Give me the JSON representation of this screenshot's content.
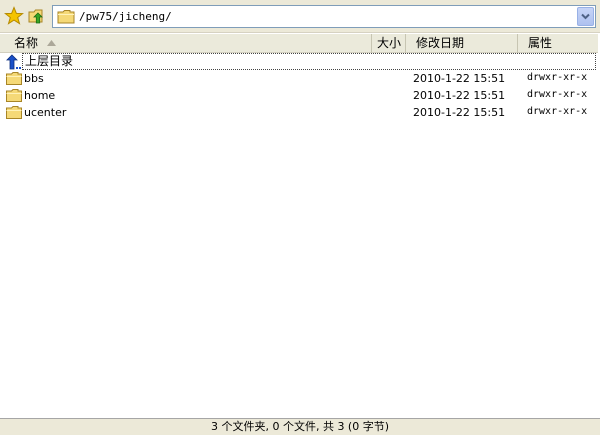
{
  "toolbar": {
    "favorites_icon": "star-icon",
    "up_icon": "folder-up-icon",
    "address": "/pw75/jicheng/"
  },
  "columns": {
    "name": "名称",
    "size": "大小",
    "date": "修改日期",
    "attr": "属性",
    "sort_column": "name",
    "sort_direction": "ascending"
  },
  "parent_row": {
    "label": "上层目录",
    "icon": "up-arrow-icon"
  },
  "files": [
    {
      "name": "bbs",
      "date": "2010-1-22 15:51",
      "attr": "drwxr-xr-x",
      "icon": "folder-icon"
    },
    {
      "name": "home",
      "date": "2010-1-22 15:51",
      "attr": "drwxr-xr-x",
      "icon": "folder-icon"
    },
    {
      "name": "ucenter",
      "date": "2010-1-22 15:51",
      "attr": "drwxr-xr-x",
      "icon": "folder-icon"
    }
  ],
  "status": {
    "text": "3 个文件夹, 0 个文件, 共 3 (0 字节)"
  },
  "colors": {
    "chrome": "#ece9d8",
    "folder": "#f5d977",
    "up_arrow": "#1a50c8",
    "star": "#f5c400"
  }
}
